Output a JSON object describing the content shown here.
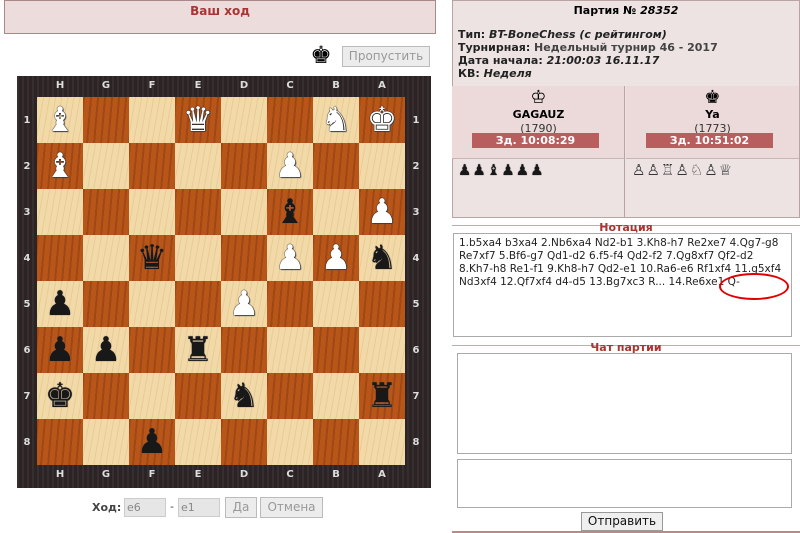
{
  "status": {
    "text": "Ваш ход"
  },
  "controls": {
    "turn_icon": "black-king-icon",
    "turn_glyph": "♚",
    "skip_label": "Пропустить"
  },
  "board": {
    "files": [
      "H",
      "G",
      "F",
      "E",
      "D",
      "C",
      "B",
      "A"
    ],
    "ranks": [
      "1",
      "2",
      "3",
      "4",
      "5",
      "6",
      "7",
      "8"
    ],
    "pieces": [
      {
        "square": "h1",
        "glyph": "♝",
        "color": "white",
        "name": "white-bishop"
      },
      {
        "square": "e1",
        "glyph": "♛",
        "color": "white",
        "name": "white-queen"
      },
      {
        "square": "b1",
        "glyph": "♞",
        "color": "white",
        "name": "white-knight"
      },
      {
        "square": "a1",
        "glyph": "♚",
        "color": "white",
        "name": "white-king"
      },
      {
        "square": "h2",
        "glyph": "♝",
        "color": "white",
        "name": "white-bishop"
      },
      {
        "square": "c2",
        "glyph": "♟",
        "color": "white",
        "name": "white-pawn"
      },
      {
        "square": "c3",
        "glyph": "♝",
        "color": "black",
        "name": "black-bishop"
      },
      {
        "square": "a3",
        "glyph": "♟",
        "color": "white",
        "name": "white-pawn"
      },
      {
        "square": "f4",
        "glyph": "♛",
        "color": "black",
        "name": "black-queen"
      },
      {
        "square": "c4",
        "glyph": "♟",
        "color": "white",
        "name": "white-pawn"
      },
      {
        "square": "b4",
        "glyph": "♟",
        "color": "white",
        "name": "white-pawn"
      },
      {
        "square": "a4",
        "glyph": "♞",
        "color": "black",
        "name": "black-knight"
      },
      {
        "square": "h5",
        "glyph": "♟",
        "color": "black",
        "name": "black-pawn"
      },
      {
        "square": "d5",
        "glyph": "♟",
        "color": "white",
        "name": "white-pawn"
      },
      {
        "square": "h6",
        "glyph": "♟",
        "color": "black",
        "name": "black-pawn"
      },
      {
        "square": "g6",
        "glyph": "♟",
        "color": "black",
        "name": "black-pawn"
      },
      {
        "square": "e6",
        "glyph": "♜",
        "color": "black",
        "name": "black-rook"
      },
      {
        "square": "h7",
        "glyph": "♚",
        "color": "black",
        "name": "black-king"
      },
      {
        "square": "d7",
        "glyph": "♞",
        "color": "black",
        "name": "black-knight"
      },
      {
        "square": "a7",
        "glyph": "♜",
        "color": "black",
        "name": "black-rook"
      },
      {
        "square": "f8",
        "glyph": "♟",
        "color": "black",
        "name": "black-pawn"
      }
    ]
  },
  "move_form": {
    "label": "Ход:",
    "from_value": "e6",
    "separator": "-",
    "to_value": "e1",
    "confirm_label": "Да",
    "cancel_label": "Отмена"
  },
  "game": {
    "title_prefix": "Партия № ",
    "number": "28352",
    "type_label": "Тип: ",
    "type_value": "BT-BoneChess (с рейтингом)",
    "tournament_label": "Турнирная: ",
    "tournament_value": "Недельный турнир 46 - 2017",
    "start_label": "Дата начала: ",
    "start_value": "21:00:03 16.11.17",
    "kv_label": "КВ: ",
    "kv_value": "Неделя"
  },
  "players": [
    {
      "icon": "white-king-icon",
      "glyph": "♔",
      "name": "GAGAUZ",
      "rating": "(1790)",
      "clock": "Зд. 10:08:29",
      "captured": "♟♟♝♟♟♟"
    },
    {
      "icon": "black-king-icon",
      "glyph": "♚",
      "name": "Ya",
      "rating": "(1773)",
      "clock": "Зд. 10:51:02",
      "captured": "♙♙♖♙♘♙♕"
    }
  ],
  "notation": {
    "title": "Нотация",
    "text": "1.b5xa4 b3xa4 2.Nb6xa4 Nd2-b1 3.Kh8-h7 Re2xe7 4.Qg7-g8 Re7xf7 5.Bf6-g7 Qd1-d2 6.f5-f4 Qd2-f2 7.Qg8xf7 Qf2-d2 8.Kh7-h8 Re1-f1 9.Kh8-h7 Qd2-e1 10.Ra6-e6 Rf1xf4 11.g5xf4 Nd3xf4 12.Qf7xf4 d4-d5 13.Bg7xc3 R... 14.Re6xe1 Q-"
  },
  "chat": {
    "title": "Чат партии",
    "send_label": "Отправить"
  },
  "colors": {
    "accent": "#aa3333",
    "clock_bg": "#b95e5e",
    "light_square": "#f2d9a8",
    "dark_square": "#b8561a",
    "annotation": "#e00000"
  }
}
